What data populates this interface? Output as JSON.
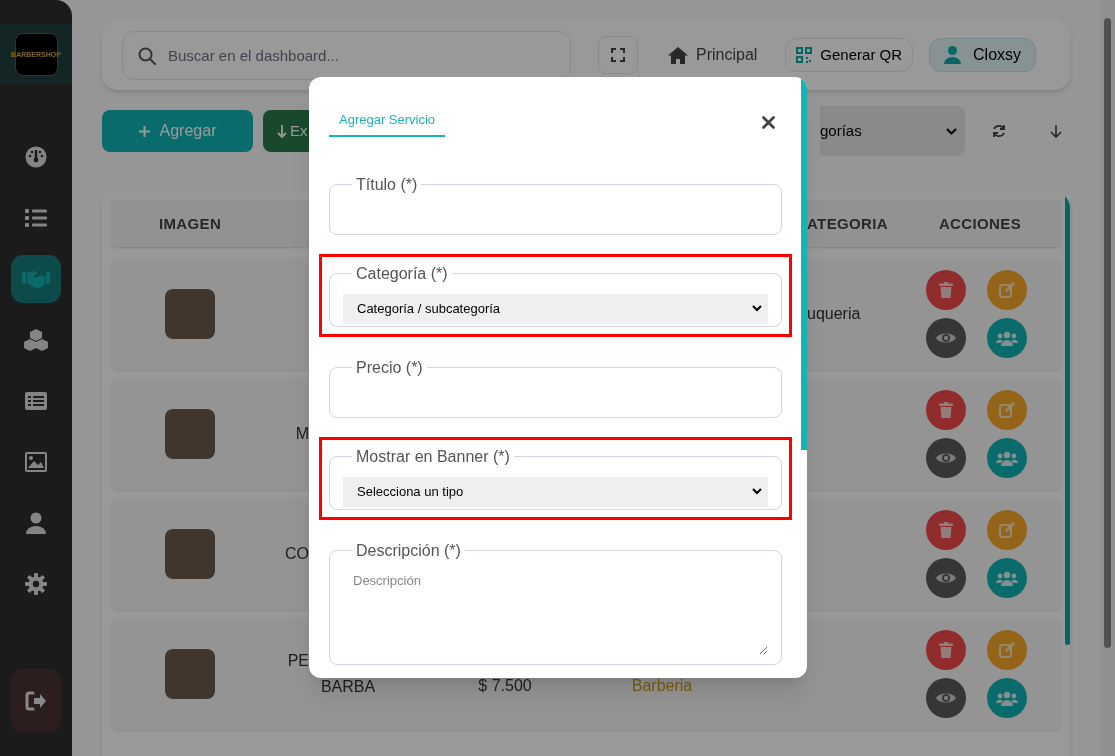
{
  "sidebar": {
    "logo_text": "BARBERSHOP",
    "items": [
      {
        "kind": "dashboard",
        "selected": false
      },
      {
        "kind": "list",
        "selected": false
      },
      {
        "kind": "handshake",
        "selected": true
      },
      {
        "kind": "cubes",
        "selected": false
      },
      {
        "kind": "listbox",
        "selected": false
      },
      {
        "kind": "image",
        "selected": false
      },
      {
        "kind": "user",
        "selected": false
      },
      {
        "kind": "settings",
        "selected": false
      }
    ]
  },
  "topbar": {
    "search_placeholder": "Buscar en el dashboard...",
    "links": [
      {
        "label": "Principal",
        "kind": "home"
      },
      {
        "label": "Generar QR",
        "kind": "qr"
      },
      {
        "label": "Cloxsy",
        "kind": "user"
      }
    ]
  },
  "toolbar": {
    "add_label": "Agregar",
    "export_label": "Ex",
    "filter_value": "gorías"
  },
  "table": {
    "columns": [
      {
        "label": "IMAGEN",
        "kind": "image"
      },
      {
        "label": "ATEGORIA",
        "kind": "category"
      },
      {
        "label": "ACCIONES",
        "kind": "actions"
      }
    ],
    "rows": [
      {
        "category": "uqueria"
      },
      {
        "name_lines": [
          {
            "text": "M",
            "clipped": true
          }
        ]
      },
      {
        "name_lines": [
          {
            "text": "CO",
            "clipped": true
          }
        ]
      },
      {
        "name_lines": [
          {
            "text": "PE",
            "clipped": true
          },
          {
            "text": "BARBA",
            "clipped": false
          }
        ],
        "price": "$ 7.500",
        "subcategory": "Barberia"
      }
    ]
  },
  "modal": {
    "tab": "Agregar Servicio",
    "fields": [
      {
        "label": "Título (*)",
        "kind": "text",
        "highlighted": false
      },
      {
        "label": "Categoría (*)",
        "kind": "select",
        "value": "Categoría / subcategoría",
        "highlighted": true
      },
      {
        "label": "Precio (*)",
        "kind": "text",
        "highlighted": false
      },
      {
        "label": "Mostrar en Banner (*)",
        "kind": "select",
        "value": "Selecciona un tipo",
        "highlighted": true
      },
      {
        "label": "Descripción (*)",
        "kind": "textarea",
        "placeholder": "Descripción",
        "highlighted": false
      }
    ]
  }
}
